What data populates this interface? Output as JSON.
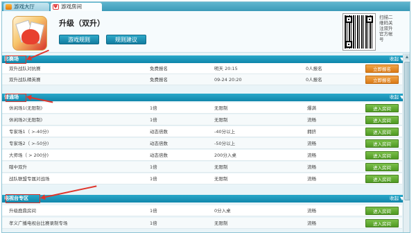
{
  "tabs": [
    {
      "label": "游戏大厅",
      "icon": "lobby-icon"
    },
    {
      "label": "游戏房间",
      "icon": "heart-icon"
    }
  ],
  "header": {
    "title": "升级（双升）",
    "rules_button": "游戏规则",
    "suggest_button": "规则建议",
    "qr_caption": [
      "扫",
      "描",
      "二",
      "维",
      "码",
      "关",
      "注",
      "双",
      "升",
      "官",
      "方",
      "帐",
      "号"
    ]
  },
  "qr_caption_lines": [
    "扫描二",
    "维码关",
    "注双升",
    "官方帐",
    "号"
  ],
  "sections": [
    {
      "title": "比赛场",
      "collapse_label": "收起",
      "rows": [
        {
          "name": "双升战队对抗赛",
          "fee": "免费报名",
          "info": "明天 20:15",
          "players": "0人报名",
          "action": "立即报名"
        },
        {
          "name": "双升战队精英赛",
          "fee": "免费报名",
          "info": "09-24 20:20",
          "players": "0人报名",
          "action": "立即报名"
        }
      ]
    },
    {
      "title": "普通场",
      "collapse_label": "收起",
      "rows": [
        {
          "name": "休闲场1(无限制)",
          "fee": "1倍",
          "info": "无限制",
          "players": "爆满",
          "action": "进入房间"
        },
        {
          "name": "休闲场2(无限制)",
          "fee": "1倍",
          "info": "无限制",
          "players": "流畅",
          "action": "进入房间"
        },
        {
          "name": "专家场1（ >-40分)",
          "fee": "动态倍数",
          "info": "-40分以上",
          "players": "拥挤",
          "action": "进入房间"
        },
        {
          "name": "专家场2（ >-50分)",
          "fee": "动态倍数",
          "info": "-50分以上",
          "players": "流畅",
          "action": "进入房间"
        },
        {
          "name": "大师场（ > 200分)",
          "fee": "动态倍数",
          "info": "200分入桌",
          "players": "流畅",
          "action": "进入房间"
        },
        {
          "name": "瞎中双升",
          "fee": "1倍",
          "info": "无限制",
          "players": "流畅",
          "action": "进入房间"
        },
        {
          "name": "战队联盟专属对战场",
          "fee": "1倍",
          "info": "无限制",
          "players": "流畅",
          "action": "进入房间"
        }
      ]
    },
    {
      "title": "电视台专区",
      "collapse_label": "收起",
      "rows": [
        {
          "name": "升级鹿鼎房间",
          "fee": "1倍",
          "info": "0分入桌",
          "players": "流畅",
          "action": "进入房间"
        },
        {
          "name": "孝义广播电视台比赛录制专场",
          "fee": "1倍",
          "info": "无限制",
          "players": "流畅",
          "action": "进入房间"
        }
      ]
    }
  ],
  "colors": {
    "section_bar": "#1a97bc",
    "orange_button": "#e38b26",
    "green_button": "#5fa834",
    "annotation": "#e0352b"
  }
}
